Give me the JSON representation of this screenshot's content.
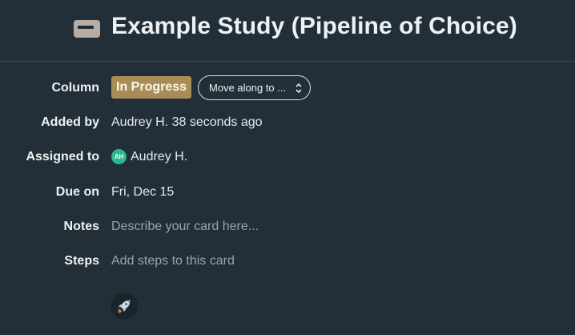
{
  "header": {
    "title": "Example Study (Pipeline of Choice)",
    "icon": "card-icon"
  },
  "fields": {
    "column": {
      "label": "Column",
      "badge": "In Progress",
      "badge_color": "#a98d58",
      "move_select": "Move along to ..."
    },
    "added_by": {
      "label": "Added by",
      "value": "Audrey H. 38 seconds ago"
    },
    "assigned_to": {
      "label": "Assigned to",
      "avatar_initials": "AH",
      "avatar_color": "#2db890",
      "value": "Audrey H."
    },
    "due_on": {
      "label": "Due on",
      "value": "Fri, Dec 15"
    },
    "notes": {
      "label": "Notes",
      "placeholder": "Describe your card here..."
    },
    "steps": {
      "label": "Steps",
      "placeholder": "Add steps to this card"
    }
  },
  "actions": {
    "rocket_icon": "rocket-icon"
  },
  "colors": {
    "background": "#232f38",
    "divider": "#3a4650"
  }
}
